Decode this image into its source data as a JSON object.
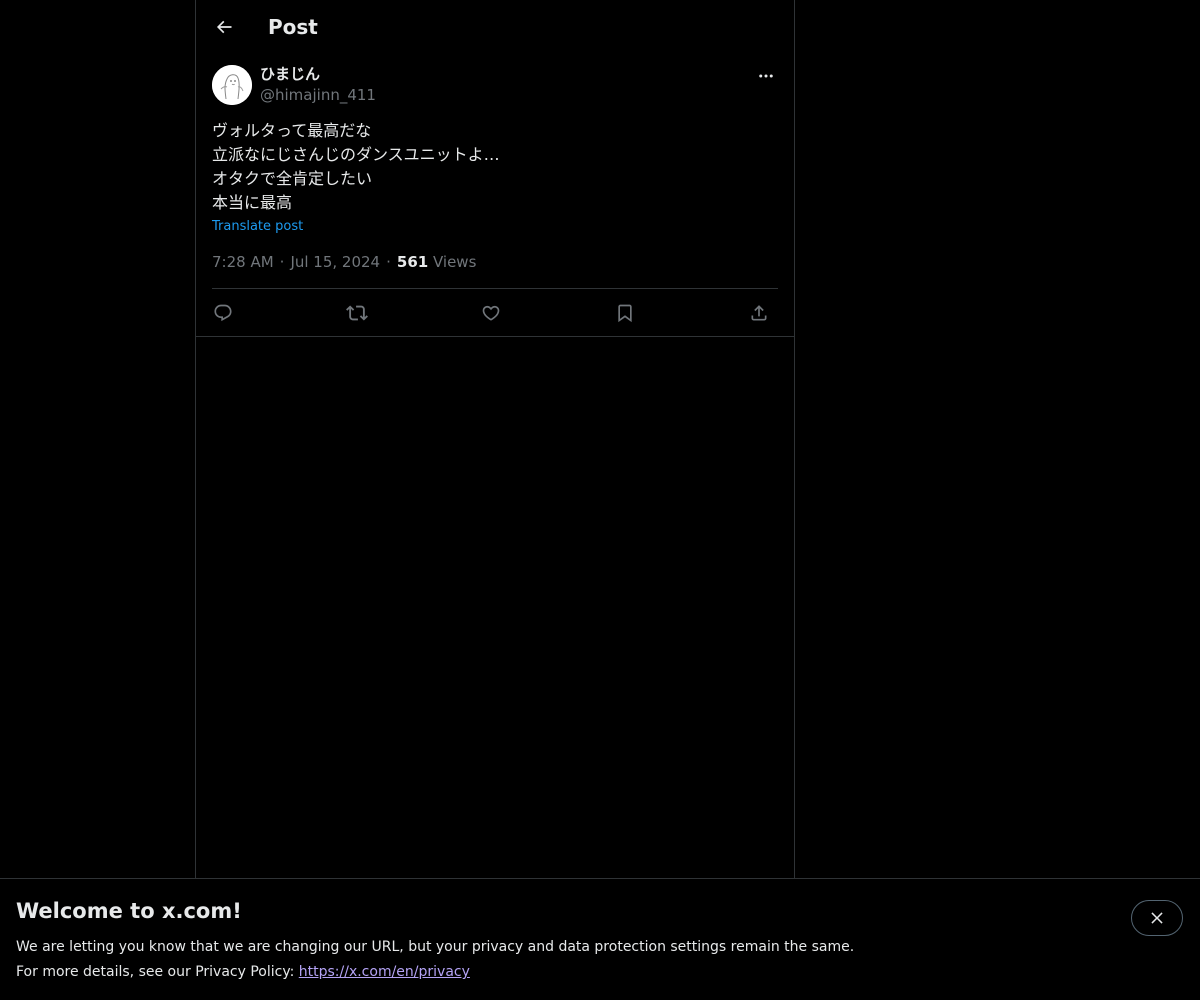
{
  "header": {
    "title": "Post",
    "back_icon": "arrow-left-icon"
  },
  "post": {
    "author": {
      "display_name": "ひまじん",
      "handle": "@himajinn_411",
      "avatar_icon": "avatar-sketch"
    },
    "text_lines": [
      "ヴォルタって最高だな",
      "立派なにじさんじのダンスユニットよ…",
      "オタクで全肯定したい",
      "本当に最高"
    ],
    "translate_label": "Translate post",
    "time": "7:28 AM",
    "separator": "·",
    "date": "Jul 15, 2024",
    "views_count": "561",
    "views_label": "Views",
    "actions": [
      {
        "name": "reply",
        "icon": "reply-icon"
      },
      {
        "name": "repost",
        "icon": "repost-icon"
      },
      {
        "name": "like",
        "icon": "heart-icon"
      },
      {
        "name": "bookmark",
        "icon": "bookmark-icon"
      },
      {
        "name": "share",
        "icon": "share-icon"
      }
    ]
  },
  "banner": {
    "title": "Welcome to x.com!",
    "line1": "We are letting you know that we are changing our URL, but your privacy and data protection settings remain the same.",
    "line2_prefix": "For more details, see our Privacy Policy: ",
    "link_text": "https://x.com/en/privacy",
    "close_icon": "close-icon"
  },
  "colors": {
    "background": "#000000",
    "text_primary": "#e7e9ea",
    "text_secondary": "#71767b",
    "accent": "#1d9bf0",
    "border": "#2f3336",
    "link": "#b4a3f5"
  }
}
